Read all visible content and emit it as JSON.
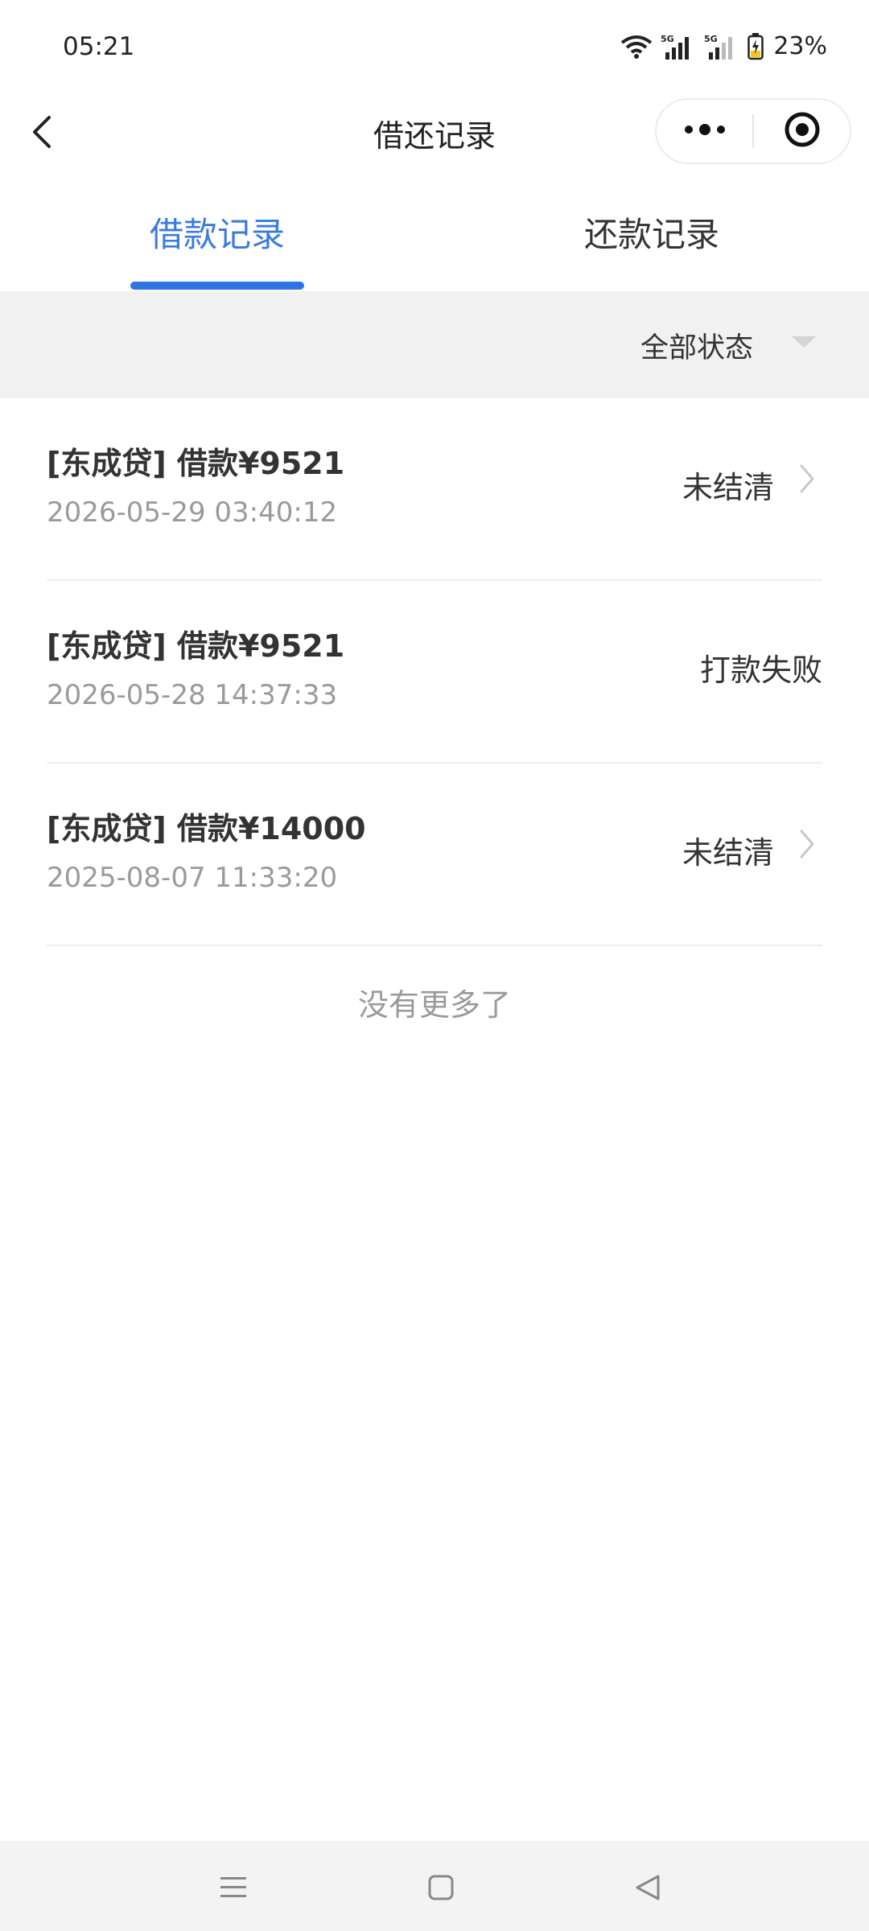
{
  "status_bar": {
    "time": "05:21",
    "battery": "23%",
    "icons": [
      "wifi-icon",
      "signal-5g-icon",
      "signal-5g-icon",
      "battery-charging-icon"
    ]
  },
  "nav": {
    "title": "借还记录",
    "back_icon": "chevron-left-icon",
    "more_icon": "more-dots-icon",
    "close_icon": "target-circle-icon"
  },
  "tabs": [
    {
      "label": "借款记录",
      "active": true
    },
    {
      "label": "还款记录",
      "active": false
    }
  ],
  "filter": {
    "label": "全部状态",
    "icon": "caret-down-icon"
  },
  "records": [
    {
      "title": "[东成贷] 借款¥9521",
      "time": "2026-05-29 03:40:12",
      "status": "未结清",
      "has_arrow": true
    },
    {
      "title": "[东成贷] 借款¥9521",
      "time": "2026-05-28 14:37:33",
      "status": "打款失败",
      "has_arrow": false
    },
    {
      "title": "[东成贷] 借款¥14000",
      "time": "2025-08-07 11:33:20",
      "status": "未结清",
      "has_arrow": true
    }
  ],
  "footer_text": "没有更多了",
  "system_nav": [
    "menu-icon",
    "home-square-icon",
    "back-triangle-icon"
  ],
  "colors": {
    "accent": "#2f74e3",
    "active_tab_text": "#3a7be0",
    "filter_bg": "#f1f1f1",
    "muted_text": "#9a9a9a"
  }
}
